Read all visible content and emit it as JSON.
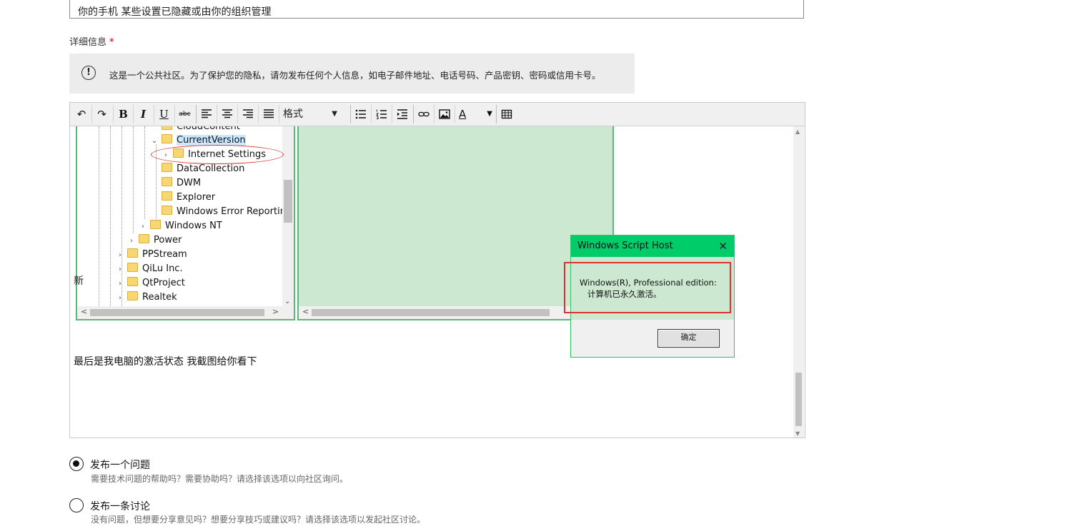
{
  "title_field": {
    "value": "你的手机   某些设置已隐藏或由你的组织管理"
  },
  "details": {
    "label": "详细信息",
    "required_mark": "*"
  },
  "privacy_notice": {
    "icon": "exclamation-circle-icon",
    "text": "这是一个公共社区。为了保护您的隐私，请勿发布任何个人信息，如电子邮件地址、电话号码、产品密钥、密码或信用卡号。"
  },
  "toolbar": {
    "undo": "↶",
    "redo": "↷",
    "bold": "B",
    "italic": "I",
    "underline": "U",
    "strike": "abc",
    "format_label": "格式",
    "font_color": "A",
    "dropdown_caret": "▼"
  },
  "registry_tree": {
    "items": [
      {
        "label": "CloudContent"
      },
      {
        "label": "CurrentVersion",
        "chevron": "⌄"
      },
      {
        "label": "Internet Settings",
        "chevron": "›"
      },
      {
        "label": "DataCollection"
      },
      {
        "label": "DWM"
      },
      {
        "label": "Explorer"
      },
      {
        "label": "Windows Error Reporting"
      },
      {
        "label": "Windows NT",
        "chevron": "›"
      },
      {
        "label": "Power",
        "chevron": "›"
      },
      {
        "label": "PPStream",
        "chevron": "›"
      },
      {
        "label": "QiLu Inc.",
        "chevron": "›"
      },
      {
        "label": "QtProject",
        "chevron": "›"
      },
      {
        "label": "Realtek",
        "chevron": "›"
      }
    ],
    "scroll_left": "<",
    "scroll_right": ">",
    "scroll_down": "⌄"
  },
  "value_pane": {
    "scroll_left": "<"
  },
  "dialog": {
    "title": "Windows Script Host",
    "close": "✕",
    "message_line1": "Windows(R), Professional edition:",
    "message_line2": "计算机已永久激活。",
    "ok_label": "确定"
  },
  "cut_char": "新",
  "body_text": "最后是我电脑的激活状态  我截图给你看下",
  "post_options": [
    {
      "title": "发布一个问题",
      "desc": "需要技术问题的帮助吗？需要协助吗？请选择该选项以向社区询问。",
      "selected": true
    },
    {
      "title": "发布一条讨论",
      "desc": "没有问题，但想要分享意见吗？想要分享技巧或建议吗？请选择该选项以发起社区讨论。",
      "selected": false
    }
  ]
}
